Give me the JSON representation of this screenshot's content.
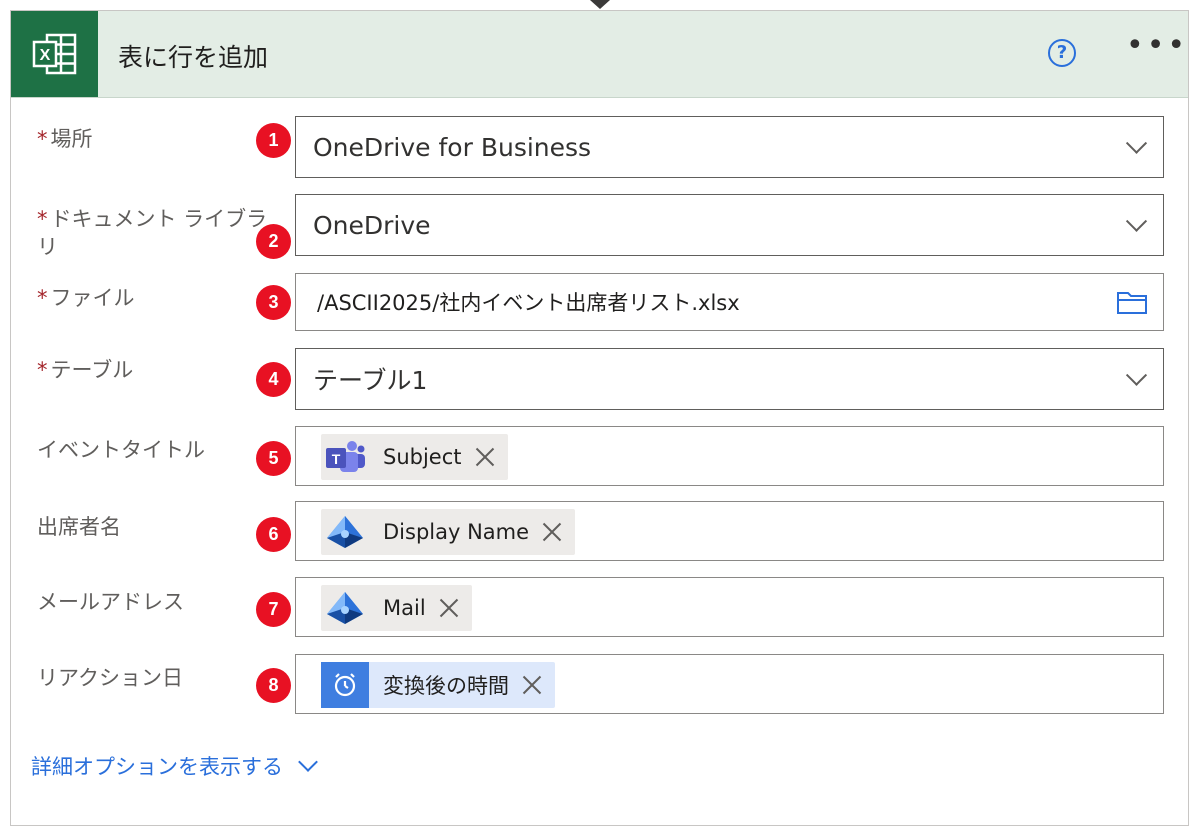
{
  "header": {
    "title": "表に行を追加",
    "help_icon": "help-circle-icon",
    "more_icon": "more-options-icon",
    "app_icon": "excel-icon",
    "accent_color": "#1e7145",
    "header_bg": "#e3ede5"
  },
  "fields": {
    "location": {
      "label": "場所",
      "required": "*",
      "value": "OneDrive for Business",
      "badge": "1"
    },
    "library": {
      "label": "ドキュメント ライブラリ",
      "required": "*",
      "value": "OneDrive",
      "badge": "2"
    },
    "file": {
      "label": "ファイル",
      "required": "*",
      "value": "/ASCII2025/社内イベント出席者リスト.xlsx",
      "badge": "3",
      "icon": "folder-icon"
    },
    "table": {
      "label": "テーブル",
      "required": "*",
      "value": "テーブル1",
      "badge": "4"
    },
    "event_title": {
      "label": "イベントタイトル",
      "badge": "5",
      "token": {
        "label": "Subject",
        "icon": "teams-icon"
      }
    },
    "attendee_name": {
      "label": "出席者名",
      "badge": "6",
      "token": {
        "label": "Display Name",
        "icon": "azure-ad-icon"
      }
    },
    "email": {
      "label": "メールアドレス",
      "badge": "7",
      "token": {
        "label": "Mail",
        "icon": "azure-ad-icon"
      }
    },
    "reaction_date": {
      "label": "リアクション日",
      "badge": "8",
      "token": {
        "label": "変換後の時間",
        "icon": "alarm-clock-icon"
      }
    }
  },
  "advanced": {
    "label": "詳細オプションを表示する"
  },
  "colors": {
    "badge": "#e81123",
    "link": "#2a6fdb",
    "required": "#a4262c"
  }
}
